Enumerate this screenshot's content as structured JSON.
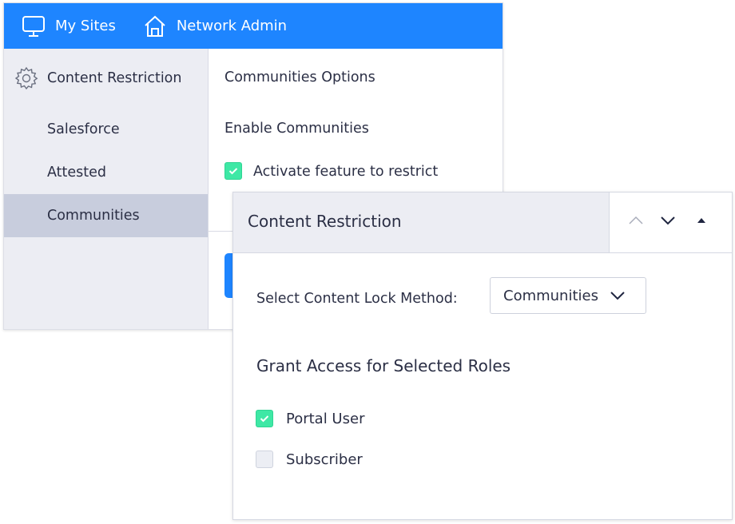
{
  "topbar": {
    "my_sites_label": "My Sites",
    "my_sites_icon": "monitor-icon",
    "network_admin_label": "Network Admin",
    "network_admin_icon": "home-icon",
    "background": "#1e85ff"
  },
  "sidebar": {
    "header_label": "Content Restriction",
    "header_icon": "gear-icon",
    "items": [
      {
        "label": "Salesforce",
        "active": false
      },
      {
        "label": "Attested",
        "active": false
      },
      {
        "label": "Communities",
        "active": true
      }
    ]
  },
  "settings": {
    "title": "Communities Options",
    "subtitle": "Enable Communities",
    "activate_label": "Activate feature to restrict",
    "activate_checked": true
  },
  "panel": {
    "title": "Content Restriction",
    "controls": [
      "chevron-up-icon",
      "chevron-down-icon",
      "triangle-up-icon"
    ],
    "lock_method_label": "Select Content Lock Method:",
    "lock_method_value": "Communities",
    "grant_heading": "Grant Access for Selected Roles",
    "roles": [
      {
        "label": "Portal User",
        "checked": true
      },
      {
        "label": "Subscriber",
        "checked": false
      }
    ],
    "accent": "#3ee8a5"
  }
}
